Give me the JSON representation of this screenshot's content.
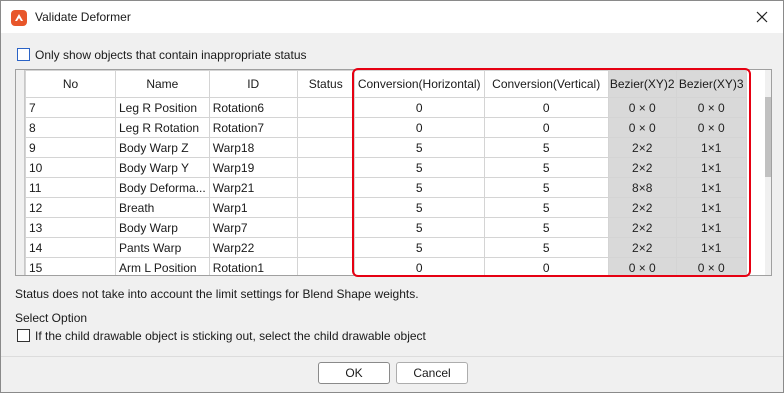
{
  "window": {
    "title": "Validate Deformer"
  },
  "options": {
    "only_inappropriate_label": "Only show objects that contain inappropriate status",
    "select_option_title": "Select Option",
    "child_drawable_label": "If the child drawable object is sticking out, select the child drawable object"
  },
  "table": {
    "columns": [
      "No",
      "Name",
      "ID",
      "Status",
      "Conversion(Horizontal)",
      "Conversion(Vertical)",
      "Bezier(XY)2",
      "Bezier(XY)3"
    ],
    "rows": [
      {
        "no": "7",
        "name": "Leg R Position",
        "id": "Rotation6",
        "status": "",
        "conv_h": "0",
        "conv_v": "0",
        "bezier2": "0 × 0",
        "bezier3": "0 × 0"
      },
      {
        "no": "8",
        "name": "Leg R Rotation",
        "id": "Rotation7",
        "status": "",
        "conv_h": "0",
        "conv_v": "0",
        "bezier2": "0 × 0",
        "bezier3": "0 × 0"
      },
      {
        "no": "9",
        "name": "Body Warp Z",
        "id": "Warp18",
        "status": "",
        "conv_h": "5",
        "conv_v": "5",
        "bezier2": "2×2",
        "bezier3": "1×1"
      },
      {
        "no": "10",
        "name": "Body Warp Y",
        "id": "Warp19",
        "status": "",
        "conv_h": "5",
        "conv_v": "5",
        "bezier2": "2×2",
        "bezier3": "1×1"
      },
      {
        "no": "11",
        "name": "Body Deforma...",
        "id": "Warp21",
        "status": "",
        "conv_h": "5",
        "conv_v": "5",
        "bezier2": "8×8",
        "bezier3": "1×1"
      },
      {
        "no": "12",
        "name": "Breath",
        "id": "Warp1",
        "status": "",
        "conv_h": "5",
        "conv_v": "5",
        "bezier2": "2×2",
        "bezier3": "1×1"
      },
      {
        "no": "13",
        "name": "Body Warp",
        "id": "Warp7",
        "status": "",
        "conv_h": "5",
        "conv_v": "5",
        "bezier2": "2×2",
        "bezier3": "1×1"
      },
      {
        "no": "14",
        "name": "Pants Warp",
        "id": "Warp22",
        "status": "",
        "conv_h": "5",
        "conv_v": "5",
        "bezier2": "2×2",
        "bezier3": "1×1"
      },
      {
        "no": "15",
        "name": "Arm L Position",
        "id": "Rotation1",
        "status": "",
        "conv_h": "0",
        "conv_v": "0",
        "bezier2": "0 × 0",
        "bezier3": "0 × 0"
      }
    ]
  },
  "status_note": "Status does not take into account the limit settings for Blend Shape weights.",
  "buttons": {
    "ok": "OK",
    "cancel": "Cancel"
  },
  "icons": {
    "app": "cubism-app-icon",
    "close": "close-icon"
  },
  "colors": {
    "highlight": "#e60012",
    "bezier_cell": "#d9d9d9",
    "app_icon": "#e8562a"
  }
}
